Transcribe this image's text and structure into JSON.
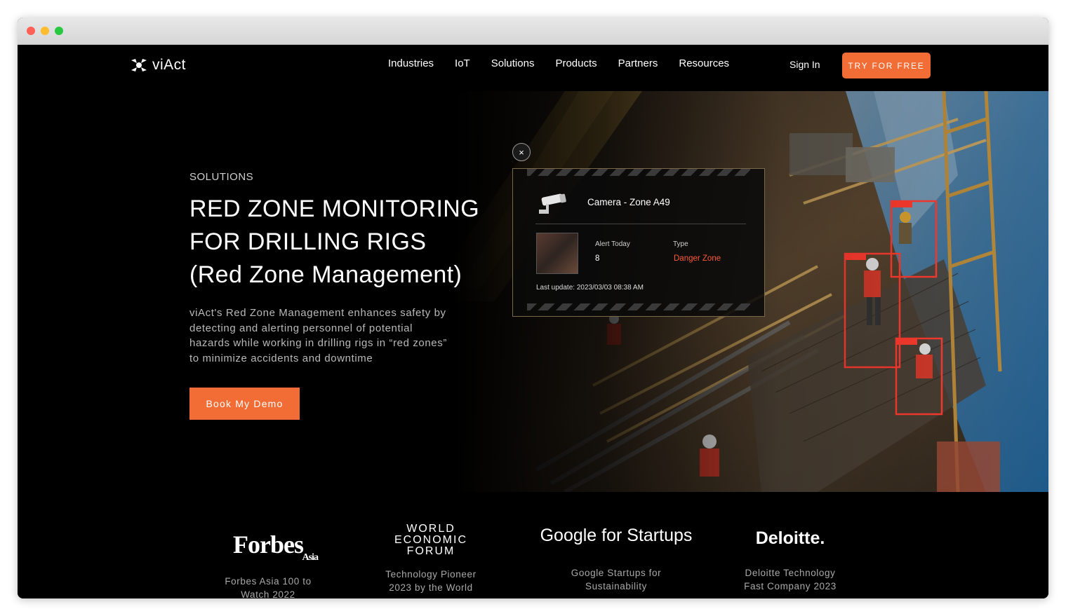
{
  "nav": {
    "brand": "viAct",
    "items": [
      "Industries",
      "IoT",
      "Solutions",
      "Products",
      "Partners",
      "Resources"
    ],
    "sign_in": "Sign In",
    "cta": "TRY FOR FREE"
  },
  "hero": {
    "kicker": "SOLUTIONS",
    "title_line1": "RED ZONE MONITORING",
    "title_line2": "FOR DRILLING RIGS",
    "title_line3": "(Red Zone Management)",
    "description": "viAct's Red Zone Management enhances safety by detecting and alerting personnel of potential hazards while working in drilling rigs in “red zones” to minimize accidents and downtime",
    "button": "Book My Demo"
  },
  "camera_card": {
    "close_symbol": "×",
    "camera_name": "Camera - Zone A49",
    "alert_label": "Alert Today",
    "alert_value": "8",
    "type_label": "Type",
    "type_value": "Danger Zone",
    "last_update": "Last update:  2023/03/03 08:38 AM"
  },
  "recognition": [
    {
      "logo": "Forbes",
      "logo_sub": "Asia",
      "caption_1": "Forbes Asia 100 to",
      "caption_2": "Watch 2022"
    },
    {
      "logo_1": "WORLD",
      "logo_2": "ECONOMIC",
      "logo_3": "FORUM",
      "caption_1": "Technology Pioneer",
      "caption_2": "2023 by the World"
    },
    {
      "logo": "Google for Startups",
      "caption_1": "Google Startups for",
      "caption_2": "Sustainability"
    },
    {
      "logo": "Deloitte.",
      "caption_1": "Deloitte Technology",
      "caption_2": "Fast Company 2023"
    }
  ],
  "colors": {
    "accent": "#f26d36",
    "danger": "#ff3b2f",
    "background": "#000000"
  }
}
